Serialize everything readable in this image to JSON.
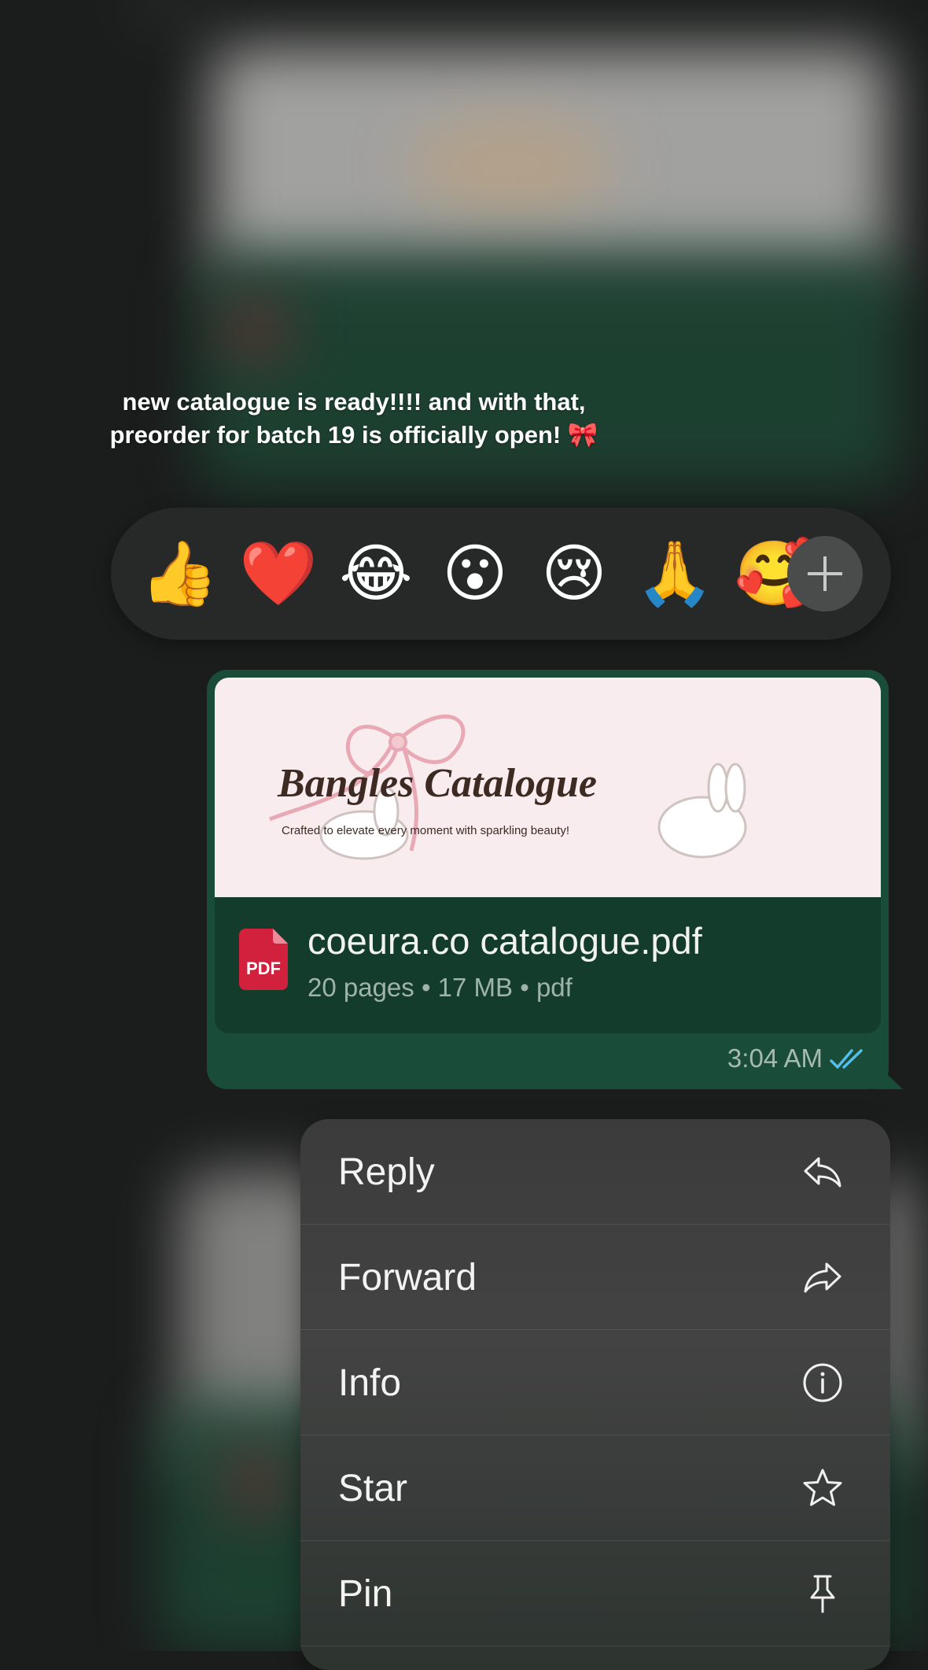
{
  "message_caption": {
    "line1": "new catalogue is ready!!!! and with that,",
    "line2": "preorder for batch 19 is officially open! 🎀"
  },
  "reactions": {
    "emojis": [
      "👍",
      "❤️",
      "😂",
      "😮",
      "😢",
      "🙏",
      "🥰"
    ],
    "more_icon": "plus-icon"
  },
  "document": {
    "preview_title": "Bangles Catalogue",
    "preview_subtitle": "Crafted to elevate every moment with sparkling beauty!",
    "type_badge": "PDF",
    "file_name": "coeura.co catalogue.pdf",
    "meta": "20 pages • 17 MB • pdf",
    "time": "3:04 AM",
    "status_icon": "double-check-read-icon",
    "status_color": "#53bdeb"
  },
  "menu": {
    "items": [
      {
        "label": "Reply",
        "icon": "reply-icon"
      },
      {
        "label": "Forward",
        "icon": "forward-icon"
      },
      {
        "label": "Info",
        "icon": "info-icon"
      },
      {
        "label": "Star",
        "icon": "star-icon"
      },
      {
        "label": "Pin",
        "icon": "pin-icon"
      }
    ]
  }
}
